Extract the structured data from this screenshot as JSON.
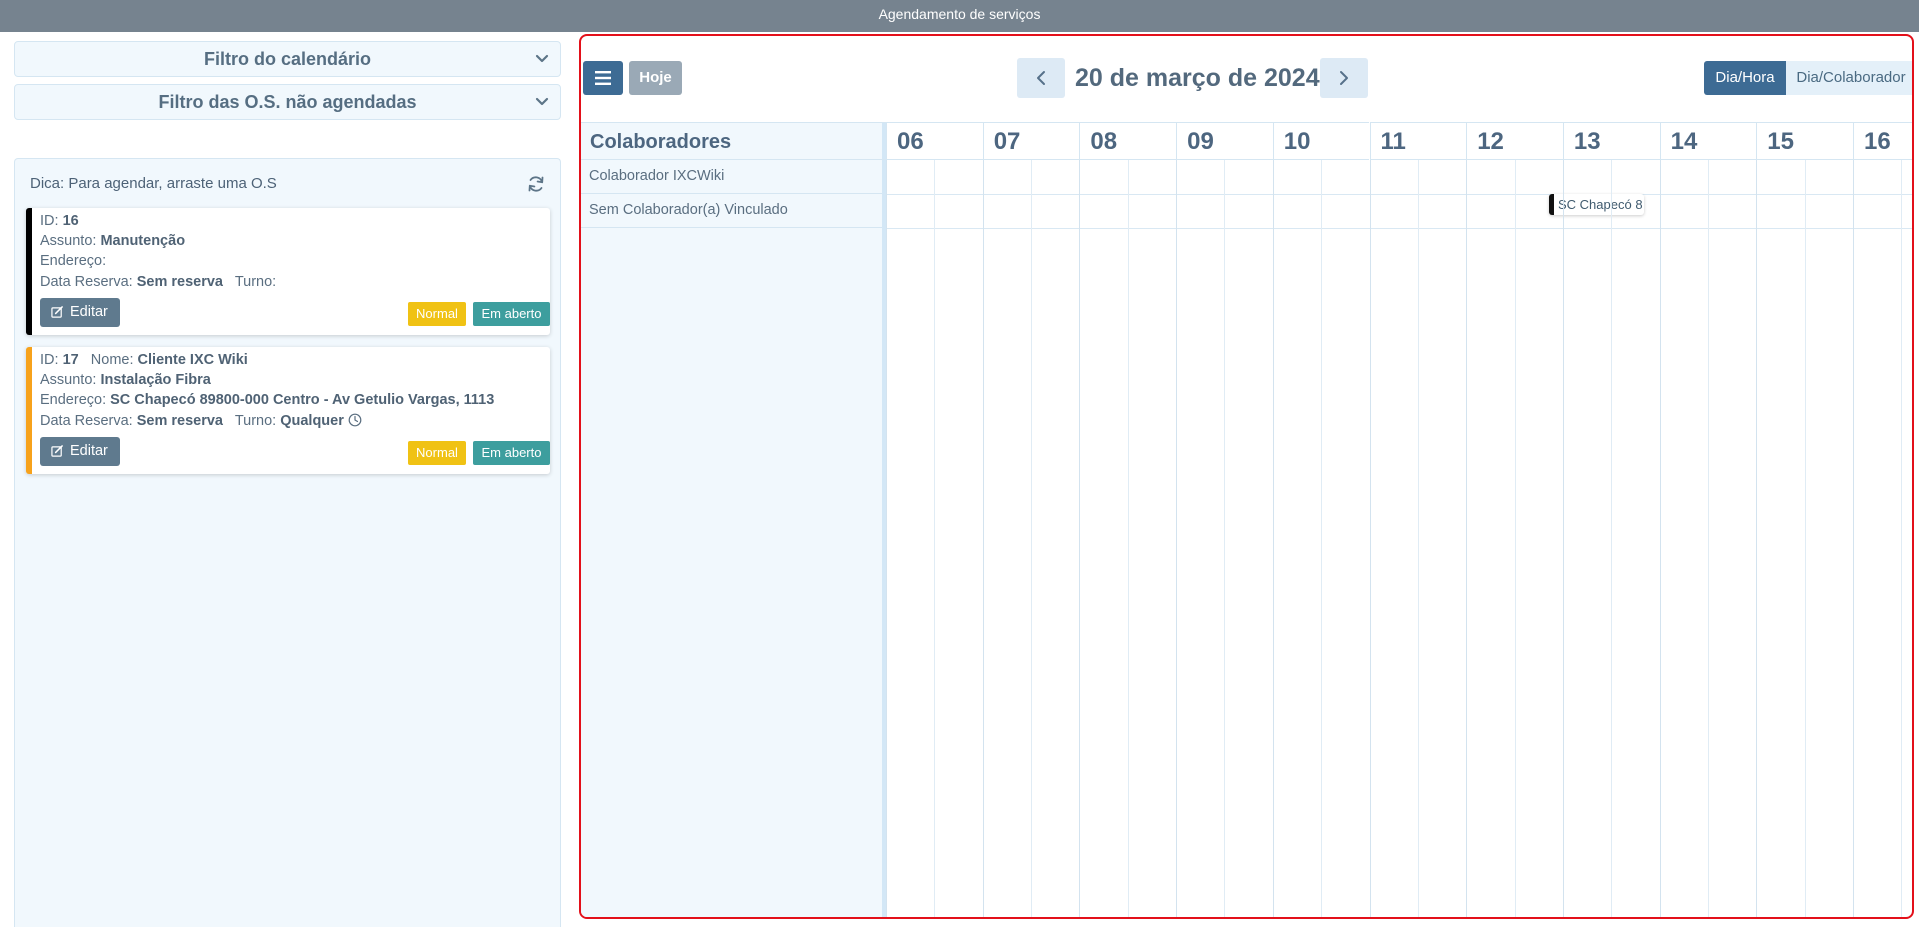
{
  "window": {
    "title": "Agendamento de serviços"
  },
  "filters": {
    "calendar_filter": "Filtro do calendário",
    "unscheduled_filter": "Filtro das O.S. não agendadas"
  },
  "unscheduled": {
    "tip": "Dica: Para agendar, arraste uma O.S",
    "cards": [
      {
        "id_label": "ID:",
        "id": "16",
        "subject_label": "Assunto:",
        "subject": "Manutenção",
        "address_label": "Endereço:",
        "address": "",
        "reserve_label": "Data Reserva:",
        "reserve": "Sem reserva",
        "shift_label": "Turno:",
        "shift": "",
        "edit_label": "Editar",
        "priority": "Normal",
        "status": "Em aberto",
        "accent_color": "#000000"
      },
      {
        "id_label": "ID:",
        "id": "17",
        "name_label": "Nome:",
        "name": "Cliente IXC Wiki",
        "subject_label": "Assunto:",
        "subject": "Instalação Fibra",
        "address_label": "Endereço:",
        "address": "SC Chapecó 89800-000 Centro - Av Getulio Vargas, 1113",
        "reserve_label": "Data Reserva:",
        "reserve": "Sem reserva",
        "shift_label": "Turno:",
        "shift": "Qualquer",
        "edit_label": "Editar",
        "priority": "Normal",
        "status": "Em aberto",
        "accent_color": "#f7a21b"
      }
    ]
  },
  "calendar": {
    "today_label": "Hoje",
    "date_title": "20 de março de 2024",
    "views": {
      "active": "Dia/Hora",
      "other": "Dia/Colaborador"
    },
    "resources_header": "Colaboradores",
    "resources": [
      "Colaborador IXCWiki",
      "Sem Colaborador(a) Vinculado"
    ],
    "hours": [
      "06",
      "07",
      "08",
      "09",
      "10",
      "11",
      "12",
      "13",
      "14",
      "15",
      "16"
    ],
    "event": {
      "label": "SC Chapecó 8"
    }
  },
  "colors": {
    "primary": "#3d6b94",
    "highlight_border": "#e3101a",
    "priority_normal": "#f0c214",
    "status_open": "#3d9e9e"
  }
}
